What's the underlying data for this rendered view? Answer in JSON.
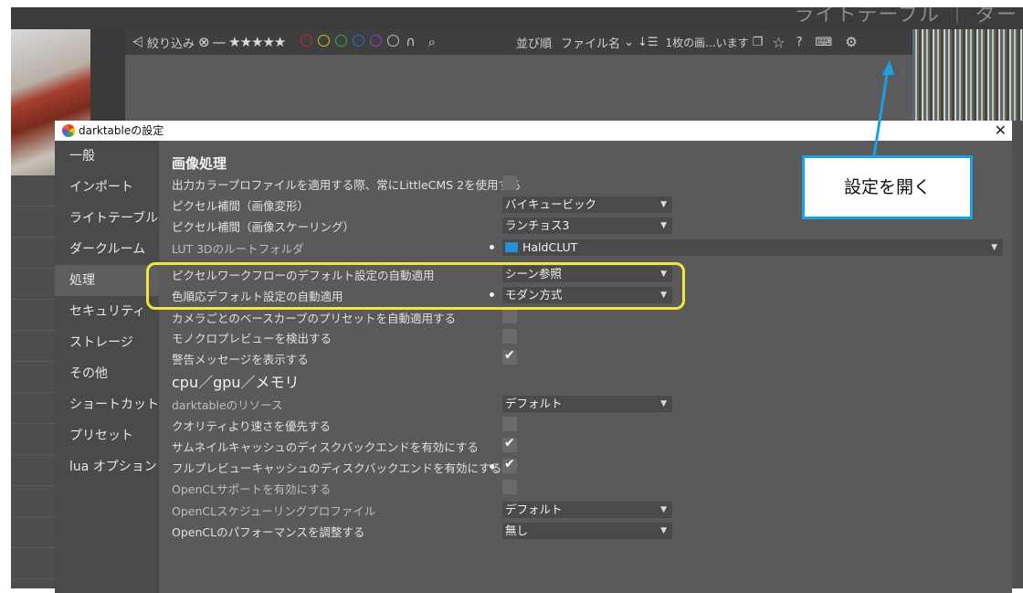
{
  "top_tabs": "ライトテーブル ｜ ダー",
  "filterbar": {
    "filter_label": "絞り込み",
    "stars": "⊗ — ★★★★★",
    "sort_label": "並び順",
    "sort_value": "ファイル名",
    "count_text": "1枚の画...います",
    "color_labels": [
      "#c8242b",
      "#d9c21c",
      "#3ba84a",
      "#2a6fd8",
      "#a13cc4",
      "#bdbdbd"
    ]
  },
  "dialog": {
    "title": "darktableの設定",
    "sidebar": [
      "一般",
      "インポート",
      "ライトテーブル",
      "ダークルーム",
      "処理",
      "セキュリティ",
      "ストレージ",
      "その他",
      "ショートカット",
      "プリセット",
      "lua オプション"
    ],
    "active_index": 4,
    "section_image": "画像処理",
    "section_cpu": "cpu／gpu／メモリ",
    "rows_image": [
      {
        "label": "出力カラープロファイルを適用する際、常にLittleCMS 2を使用する",
        "type": "checkbox",
        "checked": false
      },
      {
        "label": "ピクセル補間（画像変形）",
        "type": "combo",
        "value": "バイキュービック"
      },
      {
        "label": "ピクセル補間（画像スケーリング）",
        "type": "combo",
        "value": "ランチョス3"
      },
      {
        "label": "LUT 3Dのルートフォルダ",
        "type": "folder",
        "value": "HaldCLUT"
      },
      {
        "label": "ピクセルワークフローのデフォルト設定の自動適用",
        "type": "combo",
        "value": "シーン参照"
      },
      {
        "label": "色順応デフォルト設定の自動適用",
        "type": "combo",
        "value": "モダン方式"
      },
      {
        "label": "カメラごとのベースカーブのプリセットを自動適用する",
        "type": "checkbox",
        "checked": false
      },
      {
        "label": "モノクロプレビューを検出する",
        "type": "checkbox",
        "checked": false
      },
      {
        "label": "警告メッセージを表示する",
        "type": "checkbox",
        "checked": true
      }
    ],
    "rows_cpu": [
      {
        "label": "darktableのリソース",
        "type": "combo",
        "value": "デフォルト"
      },
      {
        "label": "クオリティより速さを優先する",
        "type": "checkbox",
        "checked": false
      },
      {
        "label": "サムネイルキャッシュのディスクバックエンドを有効にする",
        "type": "checkbox",
        "checked": true
      },
      {
        "label": "フルプレビューキャッシュのディスクバックエンドを有効にする",
        "type": "checkbox",
        "checked": true
      },
      {
        "label": "OpenCLサポートを有効にする",
        "type": "checkbox",
        "checked": false
      },
      {
        "label": "OpenCLスケジューリングプロファイル",
        "type": "combo",
        "value": "デフォルト"
      },
      {
        "label": "OpenCLのパフォーマンスを調整する",
        "type": "combo",
        "value": "無し"
      }
    ]
  },
  "annotation": {
    "callout_text": "設定を開く",
    "highlight_color": "#f0e640",
    "callout_border": "#1ba1e2"
  }
}
